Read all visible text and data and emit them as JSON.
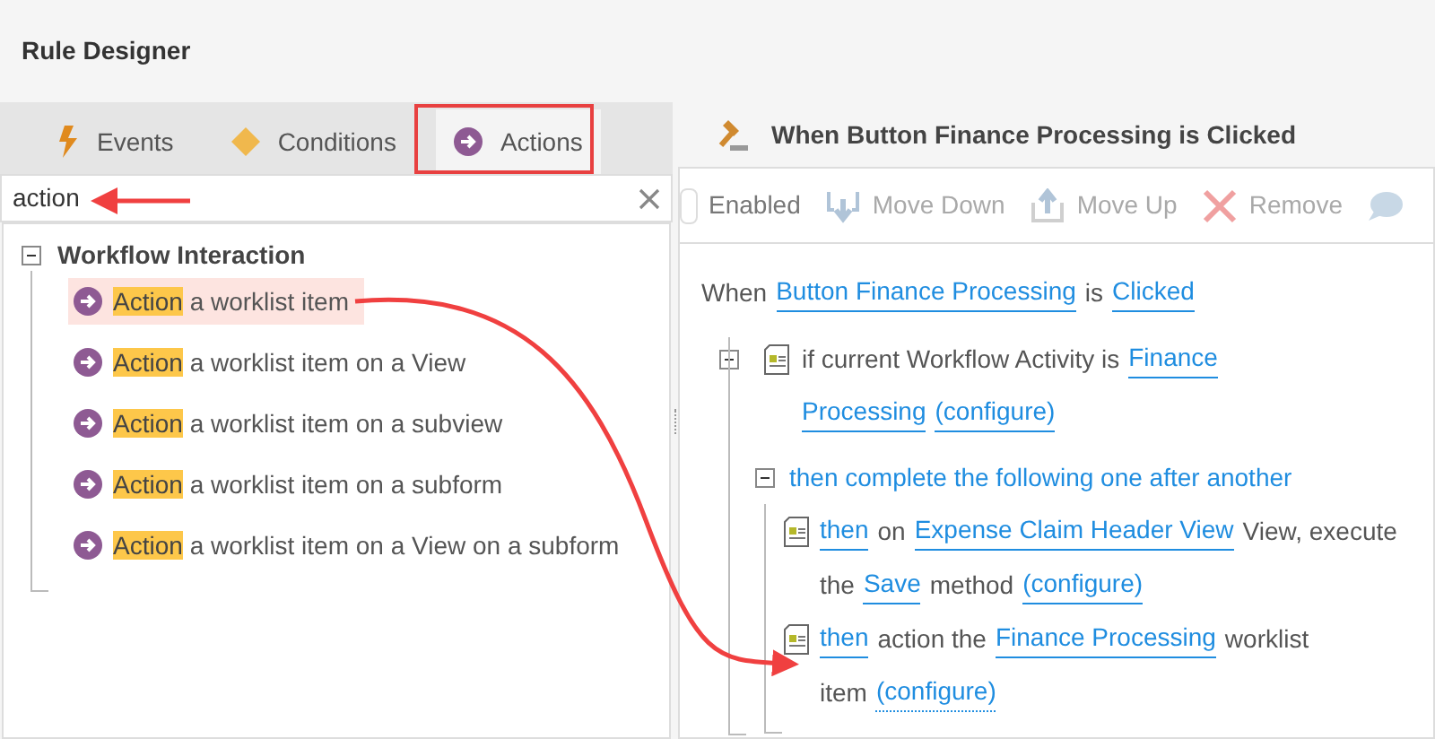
{
  "window": {
    "title": "Rule Designer"
  },
  "tabs": [
    {
      "label": "Events",
      "kind": "events",
      "selected": false
    },
    {
      "label": "Conditions",
      "kind": "conditions",
      "selected": false
    },
    {
      "label": "Actions",
      "kind": "actions",
      "selected": true
    }
  ],
  "search": {
    "value": "action"
  },
  "tree": {
    "label": "Workflow Interaction",
    "expanded": true,
    "items": [
      {
        "match": "Action",
        "rest": "a worklist item",
        "selected": true
      },
      {
        "match": "Action",
        "rest": "a worklist item on a View",
        "selected": false
      },
      {
        "match": "Action",
        "rest": "a worklist item on a subview",
        "selected": false
      },
      {
        "match": "Action",
        "rest": "a worklist item on a subform",
        "selected": false
      },
      {
        "match": "Action",
        "rest": "a worklist item on a View on a subform",
        "selected": false
      }
    ]
  },
  "rule": {
    "title": "When Button Finance Processing is Clicked",
    "toolbar": [
      {
        "label": "Enabled",
        "kind": "checkbox",
        "disabled": false,
        "checked": false
      },
      {
        "label": "Move Down",
        "kind": "move-down",
        "disabled": true
      },
      {
        "label": "Move Up",
        "kind": "move-up",
        "disabled": true
      },
      {
        "label": "Remove",
        "kind": "remove",
        "disabled": true
      },
      {
        "kind": "comment",
        "disabled": true
      }
    ],
    "when": [
      {
        "kind": "text",
        "text": "When"
      },
      {
        "kind": "link",
        "text": "Button Finance Processing"
      },
      {
        "kind": "text",
        "text": "is"
      },
      {
        "kind": "link",
        "text": "Clicked"
      }
    ],
    "condition": {
      "expanded": true,
      "lines": [
        [
          {
            "kind": "text",
            "text": "if current Workflow Activity is"
          },
          {
            "kind": "link",
            "text": "Finance"
          }
        ],
        [
          {
            "kind": "link",
            "text": "Processing"
          },
          {
            "kind": "link",
            "text": "(configure)"
          }
        ]
      ],
      "group": {
        "text": "then complete the following one after another",
        "expanded": true,
        "actions": [
          {
            "lines": [
              [
                {
                  "kind": "link",
                  "text": "then"
                },
                {
                  "kind": "text",
                  "text": "on"
                },
                {
                  "kind": "link",
                  "text": "Expense Claim Header View"
                },
                {
                  "kind": "text",
                  "text": "View, execute"
                }
              ],
              [
                {
                  "kind": "text",
                  "text": "the"
                },
                {
                  "kind": "link",
                  "text": "Save"
                },
                {
                  "kind": "text",
                  "text": "method"
                },
                {
                  "kind": "link",
                  "text": "(configure)"
                }
              ]
            ]
          },
          {
            "lines": [
              [
                {
                  "kind": "link",
                  "text": "then"
                },
                {
                  "kind": "text",
                  "text": "action the"
                },
                {
                  "kind": "link",
                  "text": "Finance Processing"
                },
                {
                  "kind": "text",
                  "text": "worklist"
                }
              ],
              [
                {
                  "kind": "text",
                  "text": "item"
                },
                {
                  "kind": "dotted-link",
                  "text": "(configure)"
                }
              ]
            ]
          }
        ]
      }
    }
  }
}
